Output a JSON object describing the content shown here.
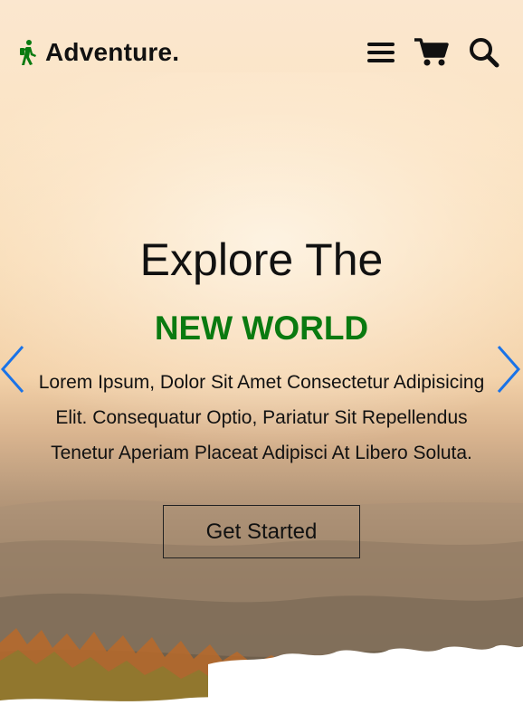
{
  "brand": {
    "name": "Adventure.",
    "icon": "hiker-icon",
    "icon_color": "#0a7a10"
  },
  "header": {
    "icons": [
      "menu-icon",
      "cart-icon",
      "search-icon"
    ]
  },
  "hero": {
    "title": "Explore The",
    "subtitle": "NEW WORLD",
    "subtitle_color": "#0a7a10",
    "description": "Lorem Ipsum, Dolor Sit Amet Consectetur Adipisicing Elit. Consequatur Optio, Pariatur Sit Repellendus Tenetur Aperiam Placeat Adipisci At Libero Soluta.",
    "cta_label": "Get Started",
    "arrow_color": "#1a73e8"
  }
}
